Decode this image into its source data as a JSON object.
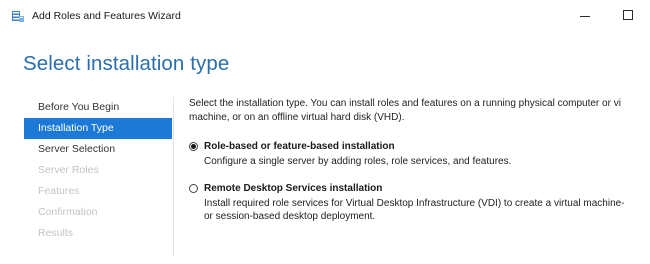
{
  "window": {
    "title": "Add Roles and Features Wizard",
    "minimize_icon": "minimize-icon",
    "maximize_icon": "maximize-icon",
    "app_icon": "server-manager-icon"
  },
  "page_title": "Select installation type",
  "nav": {
    "items": [
      {
        "label": "Before You Begin",
        "state": "normal"
      },
      {
        "label": "Installation Type",
        "state": "active"
      },
      {
        "label": "Server Selection",
        "state": "normal"
      },
      {
        "label": "Server Roles",
        "state": "disabled"
      },
      {
        "label": "Features",
        "state": "disabled"
      },
      {
        "label": "Confirmation",
        "state": "disabled"
      },
      {
        "label": "Results",
        "state": "disabled"
      }
    ]
  },
  "content": {
    "intro_line1": "Select the installation type. You can install roles and features on a running physical computer or vi",
    "intro_line2": "machine, or on an offline virtual hard disk (VHD).",
    "options": [
      {
        "label": "Role-based or feature-based installation",
        "selected": true,
        "desc_line1": "Configure a single server by adding roles, role services, and features.",
        "desc_line2": ""
      },
      {
        "label": "Remote Desktop Services installation",
        "selected": false,
        "desc_line1": "Install required role services for Virtual Desktop Infrastructure (VDI) to create a virtual machine-",
        "desc_line2": "or session-based desktop deployment."
      }
    ]
  },
  "colors": {
    "title_blue": "#2a6ead",
    "nav_active_bg": "#1c7ad6",
    "nav_disabled_text": "#c4c4c4"
  }
}
